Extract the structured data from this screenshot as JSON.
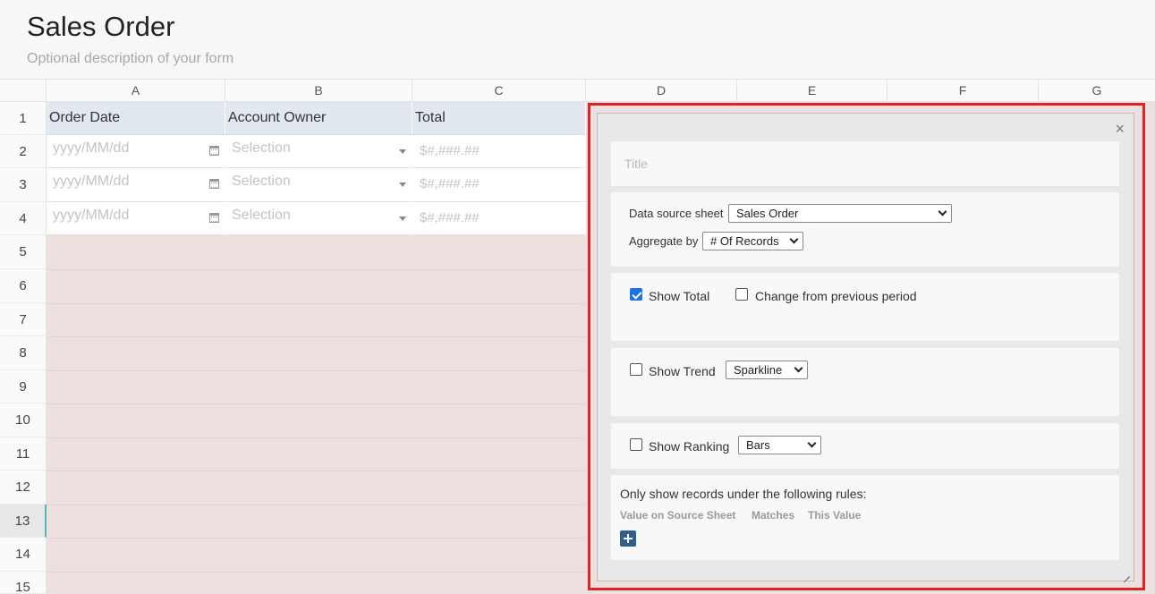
{
  "form": {
    "title": "Sales Order",
    "description": "Optional description of your form"
  },
  "columns": [
    "A",
    "B",
    "C",
    "D",
    "E",
    "F",
    "G"
  ],
  "rows": [
    "1",
    "2",
    "3",
    "4",
    "5",
    "6",
    "7",
    "8",
    "9",
    "10",
    "11",
    "12",
    "13",
    "14",
    "15"
  ],
  "active_row": "13",
  "table": {
    "headers": [
      "Order Date",
      "Account Owner",
      "Total"
    ],
    "placeholders": {
      "date": "yyyy/MM/dd",
      "selection": "Selection",
      "currency": "$#,###.##"
    }
  },
  "panel": {
    "close_label": "×",
    "title_placeholder": "Title",
    "data_source_label": "Data source sheet",
    "data_source_value": "Sales Order",
    "aggregate_label": "Aggregate by",
    "aggregate_value": "# Of Records",
    "show_total_label": "Show Total",
    "show_total_checked": true,
    "change_label": "Change from previous period",
    "change_checked": false,
    "show_trend_label": "Show Trend",
    "show_trend_checked": false,
    "trend_value": "Sparkline",
    "show_ranking_label": "Show Ranking",
    "show_ranking_checked": false,
    "ranking_value": "Bars",
    "rules_title": "Only show records under the following rules:",
    "rules_columns": [
      "Value on Source Sheet",
      "Matches",
      "This Value"
    ]
  },
  "colors": {
    "highlight": "#e02424",
    "header_bg": "#e2e8ef",
    "empty_cell": "#efe0e0",
    "checkbox_on": "#1a73e8",
    "add_button": "#2f5f8a"
  }
}
